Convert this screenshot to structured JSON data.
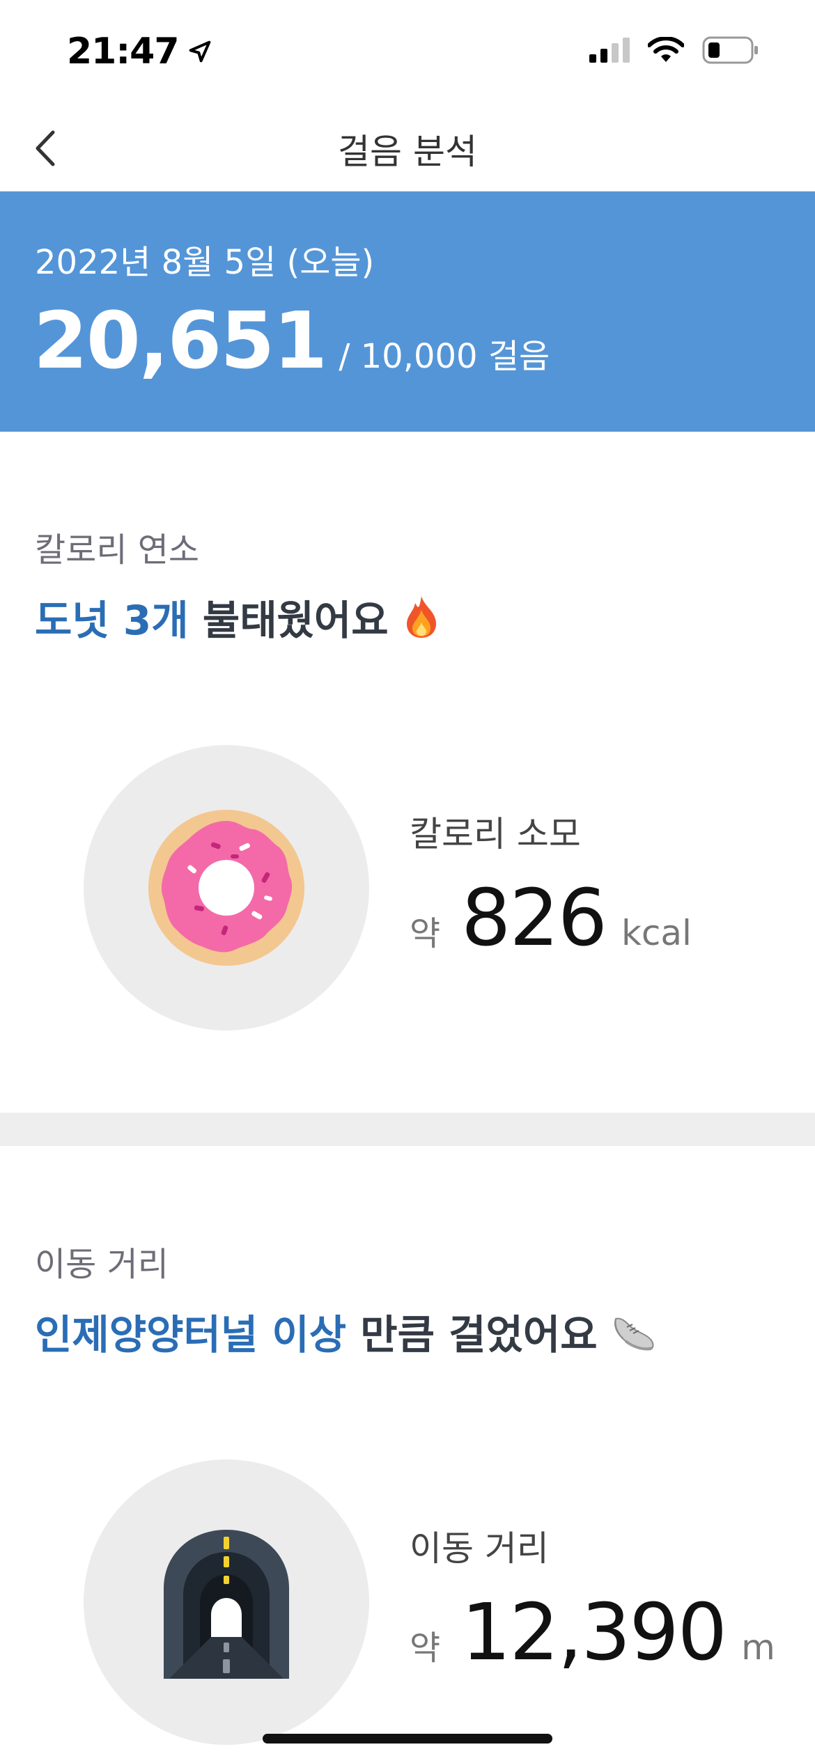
{
  "status_bar": {
    "time": "21:47"
  },
  "nav": {
    "title": "걸음 분석"
  },
  "hero": {
    "date": "2022년 8월 5일 (오늘)",
    "steps": "20,651",
    "goal": "/ 10,000 걸음",
    "background_color": "#5495d8"
  },
  "calorie_section": {
    "label": "칼로리 연소",
    "headline_highlight": "도넛 3개",
    "headline_rest": " 불태웠어요",
    "headline_icon": "fire-icon",
    "illustration": "donut-icon",
    "stat_label": "칼로리 소모",
    "stat_prefix": "약",
    "stat_value": "826",
    "stat_unit": "kcal"
  },
  "distance_section": {
    "label": "이동 거리",
    "headline_highlight": "인제양양터널 이상",
    "headline_rest": " 만큼 걸었어요",
    "headline_icon": "sneaker-icon",
    "illustration": "tunnel-icon",
    "stat_label": "이동 거리",
    "stat_prefix": "약",
    "stat_value": "12,390",
    "stat_unit": "m"
  },
  "colors": {
    "highlight": "#2a6db5",
    "headline": "#333a44"
  }
}
